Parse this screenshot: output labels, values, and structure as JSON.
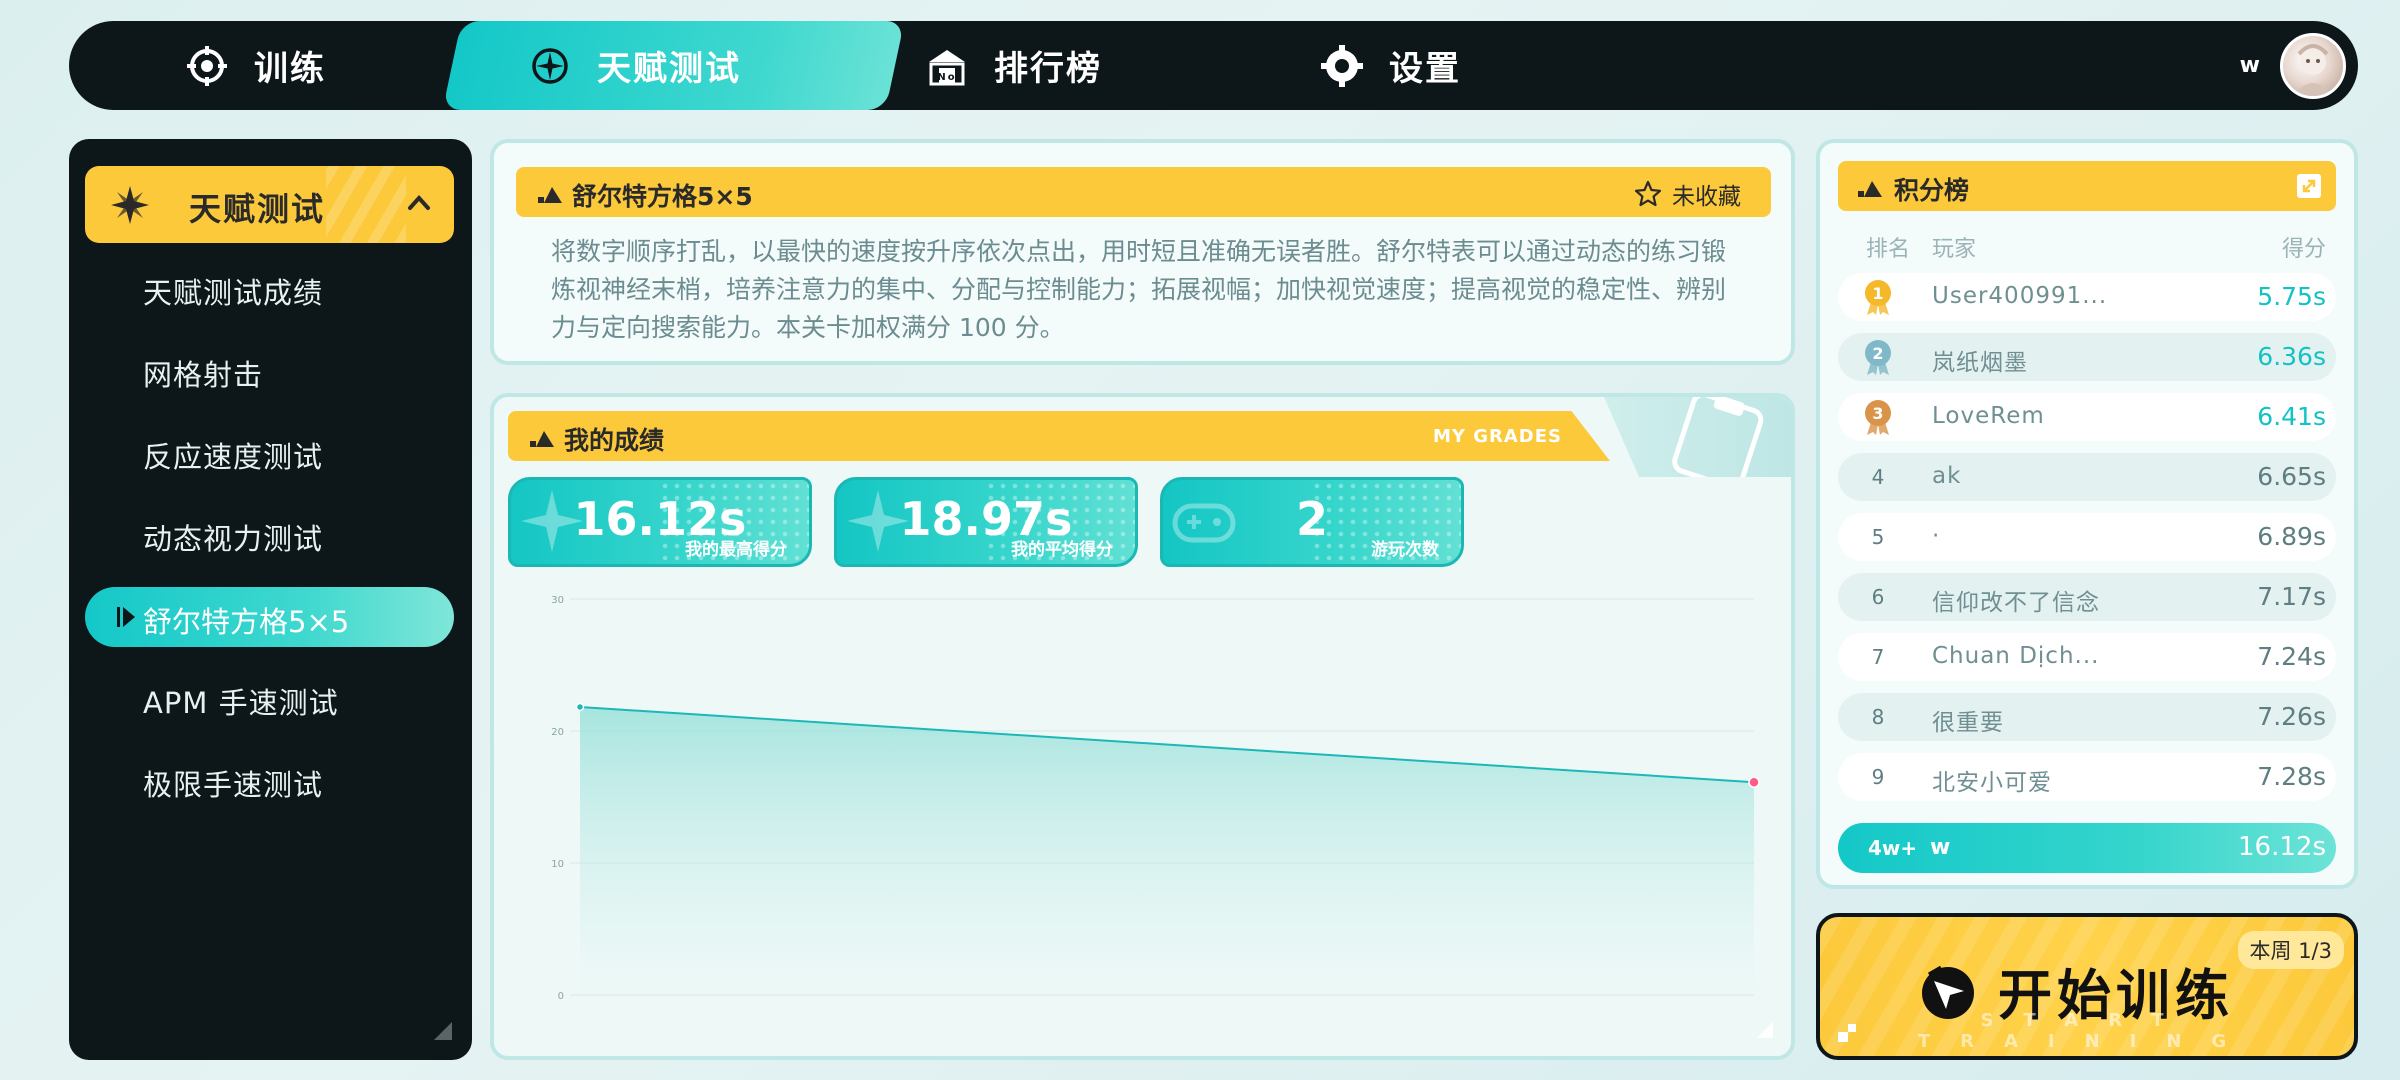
{
  "nav": {
    "tabs": [
      {
        "label": "训练",
        "icon": "crosshair-icon"
      },
      {
        "label": "天赋测试",
        "icon": "compass-icon",
        "active": true
      },
      {
        "label": "排行榜",
        "icon": "podium-icon"
      },
      {
        "label": "设置",
        "icon": "gear-icon"
      }
    ],
    "user": "w"
  },
  "sidebar": {
    "header": "天赋测试",
    "items": [
      {
        "label": "天赋测试成绩"
      },
      {
        "label": "网格射击"
      },
      {
        "label": "反应速度测试"
      },
      {
        "label": "动态视力测试"
      },
      {
        "label": "舒尔特方格5×5",
        "active": true
      },
      {
        "label": "APM 手速测试"
      },
      {
        "label": "极限手速测试"
      }
    ]
  },
  "info": {
    "title": "舒尔特方格5×5",
    "favorite": "未收藏",
    "description": "将数字顺序打乱，以最快的速度按升序依次点出，用时短且准确无误者胜。舒尔特表可以通过动态的练习锻炼视神经末梢，培养注意力的集中、分配与控制能力；拓展视幅；加快视觉速度；提高视觉的稳定性、辨别力与定向搜索能力。本关卡加权满分 100 分。"
  },
  "grades": {
    "title": "我的成绩",
    "subtitle": "MY GRADES",
    "stats": [
      {
        "value": "16.12s",
        "label": "我的最高得分"
      },
      {
        "value": "18.97s",
        "label": "我的平均得分"
      },
      {
        "value": "2",
        "label": "游玩次数"
      }
    ]
  },
  "chart_data": {
    "type": "area",
    "x": [
      1,
      2
    ],
    "values": [
      21.82,
      16.12
    ],
    "ylim": [
      0,
      30
    ],
    "yticks": [
      "0",
      "10",
      "20",
      "30"
    ],
    "grid": true,
    "colors": {
      "line": "#1bb8b8",
      "start_point": "#1bb8b8",
      "end_point": "#ff5a8a"
    }
  },
  "leaderboard": {
    "title": "积分榜",
    "headers": {
      "rank": "排名",
      "player": "玩家",
      "score": "得分"
    },
    "rows": [
      {
        "rank": "1",
        "player": "User400991...",
        "score": "5.75s"
      },
      {
        "rank": "2",
        "player": "岚纸烟墨",
        "score": "6.36s"
      },
      {
        "rank": "3",
        "player": "LoveRem",
        "score": "6.41s"
      },
      {
        "rank": "4",
        "player": "ak",
        "score": "6.65s"
      },
      {
        "rank": "5",
        "player": "·",
        "score": "6.89s"
      },
      {
        "rank": "6",
        "player": "信仰改不了信念",
        "score": "7.17s"
      },
      {
        "rank": "7",
        "player": "Chuan Dịch...",
        "score": "7.24s"
      },
      {
        "rank": "8",
        "player": "很重要",
        "score": "7.26s"
      },
      {
        "rank": "9",
        "player": "北安小可爱",
        "score": "7.28s"
      }
    ],
    "me": {
      "rank": "4w+",
      "player": "w",
      "score": "16.12s"
    }
  },
  "start": {
    "label": "开始训练",
    "subtitle": "START TRAINING",
    "week": "本周 1/3"
  },
  "colors": {
    "accent": "#14c8c8",
    "yellow": "#fcc93b",
    "dark": "#0d1619",
    "gold": "#f5b829",
    "silver": "#7fb8c8",
    "bronze": "#d9944a"
  }
}
